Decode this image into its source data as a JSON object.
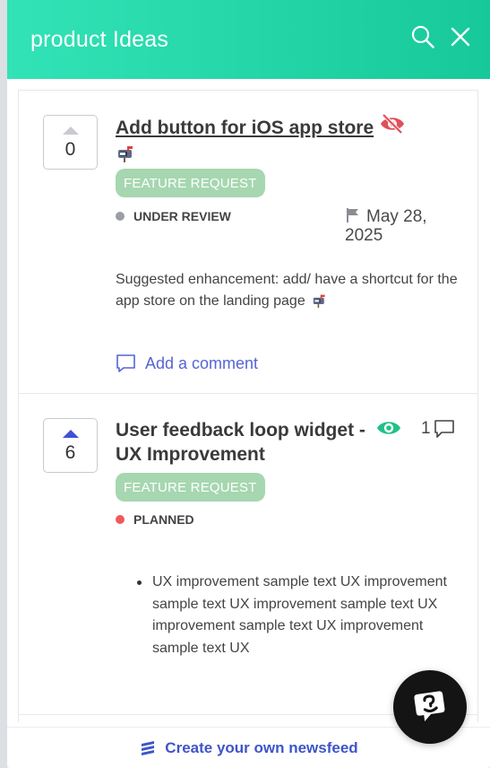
{
  "header": {
    "title": "product Ideas",
    "search_icon": "search-icon",
    "close_icon": "close-icon",
    "gradient_start": "#31e3b6",
    "gradient_end": "#17c99a"
  },
  "posts": [
    {
      "votes": "0",
      "upvoted": false,
      "title": "Add button for iOS app store",
      "title_icon": "eye-off-icon",
      "title_emoji": "mailbox-icon",
      "tag": "FEATURE REQUEST",
      "status": "UNDER REVIEW",
      "status_color": "#9b9ea3",
      "date_line1": "May 28,",
      "date_line2": "2025",
      "date_icon": "flag-icon",
      "body": "Suggested enhancement: add/ have a shortcut for the app store on the landing page",
      "body_emoji": "mailbox-icon",
      "add_comment": "Add a comment"
    },
    {
      "votes": "6",
      "upvoted": true,
      "title_line1": "User feedback loop widget -",
      "title_line2": "UX Improvement",
      "title_icon": "eye-icon",
      "comment_count": "1",
      "tag": "FEATURE REQUEST",
      "status": "PLANNED",
      "status_color": "#f05a5a",
      "bullets": [
        "UX improvement sample text UX improvement sample text UX improvement sample text UX improvement sample text UX improvement sample text UX"
      ]
    }
  ],
  "footer": {
    "link": "Create your own newsfeed",
    "icon": "newsfeed-logo-icon"
  },
  "chat": {
    "icon": "chat-support-icon"
  },
  "colors": {
    "accent": "#5565d5",
    "tag_bg": "#a6d7b0",
    "upvote_active": "#3f51d6",
    "eye_off": "#e0505a",
    "eye_on": "#22c187"
  }
}
